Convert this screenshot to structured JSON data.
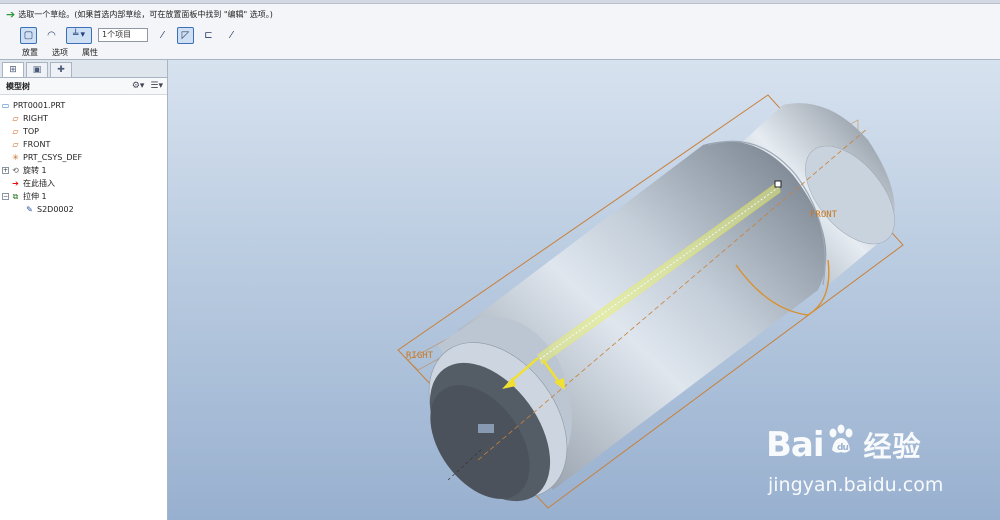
{
  "dashboard": {
    "prompt": "选取一个草绘。(如果首选内部草绘，可在放置面板中找到 \"编辑\" 选项。)",
    "item_field_value": "1个项目",
    "tabs": [
      "放置",
      "选项",
      "属性"
    ]
  },
  "model_tree": {
    "title": "模型树",
    "items": [
      {
        "label": "PRT0001.PRT",
        "icon": "part-icon"
      },
      {
        "label": "RIGHT",
        "icon": "datum-plane-icon"
      },
      {
        "label": "TOP",
        "icon": "datum-plane-icon"
      },
      {
        "label": "FRONT",
        "icon": "datum-plane-icon"
      },
      {
        "label": "PRT_CSYS_DEF",
        "icon": "csys-icon"
      },
      {
        "label": "旋转 1",
        "icon": "revolve-icon"
      },
      {
        "label": "在此插入",
        "icon": "insert-here-icon"
      },
      {
        "label": "拉伸 1",
        "icon": "extrude-icon"
      },
      {
        "label": "S2D0002",
        "icon": "sketch-icon"
      }
    ]
  },
  "viewport": {
    "plane_labels": {
      "front": "FRONT",
      "right": "RIGHT"
    }
  },
  "watermark": {
    "brand_left": "Bai",
    "brand_right": "du",
    "brand_cn": "经验",
    "url": "jingyan.baidu.com"
  }
}
